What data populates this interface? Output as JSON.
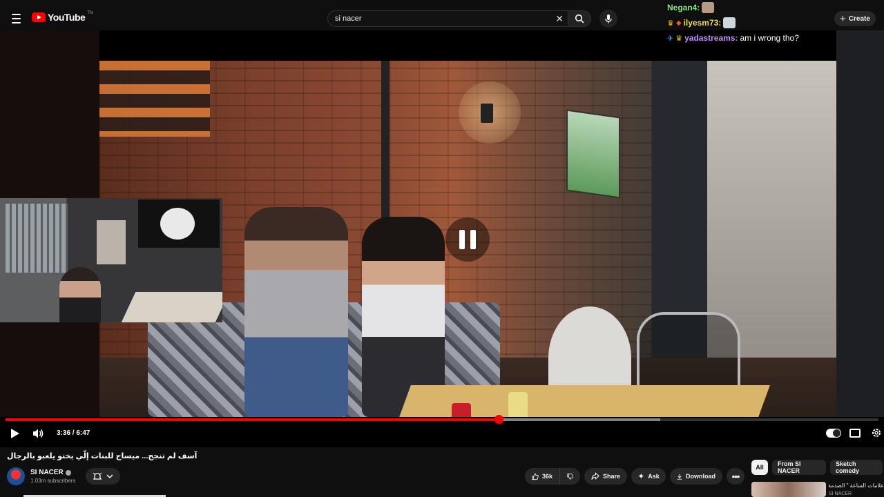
{
  "header": {
    "logo_text": "YouTube",
    "logo_superscript": "TN",
    "search_value": "si nacer",
    "create_label": "Create"
  },
  "chat": [
    {
      "user": "Negan4:",
      "message": ""
    },
    {
      "user": "ilyesm73:",
      "message": ""
    },
    {
      "user": "yadastreams:",
      "message": "am i wrong tho?"
    }
  ],
  "player": {
    "time": "3:36 / 6:47",
    "progress": 0.565
  },
  "video": {
    "title": "آسف لم تنجح... ميساج للبنات إلّي يختو يلعبو بالرجال"
  },
  "channel": {
    "name": "SI NACER",
    "subscribers": "1.03m subscribers"
  },
  "actions": {
    "like_count": "36k",
    "share_label": "Share",
    "ask_label": "Ask",
    "download_label": "Download"
  },
  "filters": {
    "chips": [
      "All",
      "From SI NACER",
      "Sketch comedy"
    ]
  },
  "recommendation": {
    "title": "علامات الساعة \" الصدمة \"",
    "channel": "SI NACER"
  },
  "colors": {
    "accent": "#ff0000",
    "background": "#0f0f0f",
    "chip_bg": "#272727"
  }
}
